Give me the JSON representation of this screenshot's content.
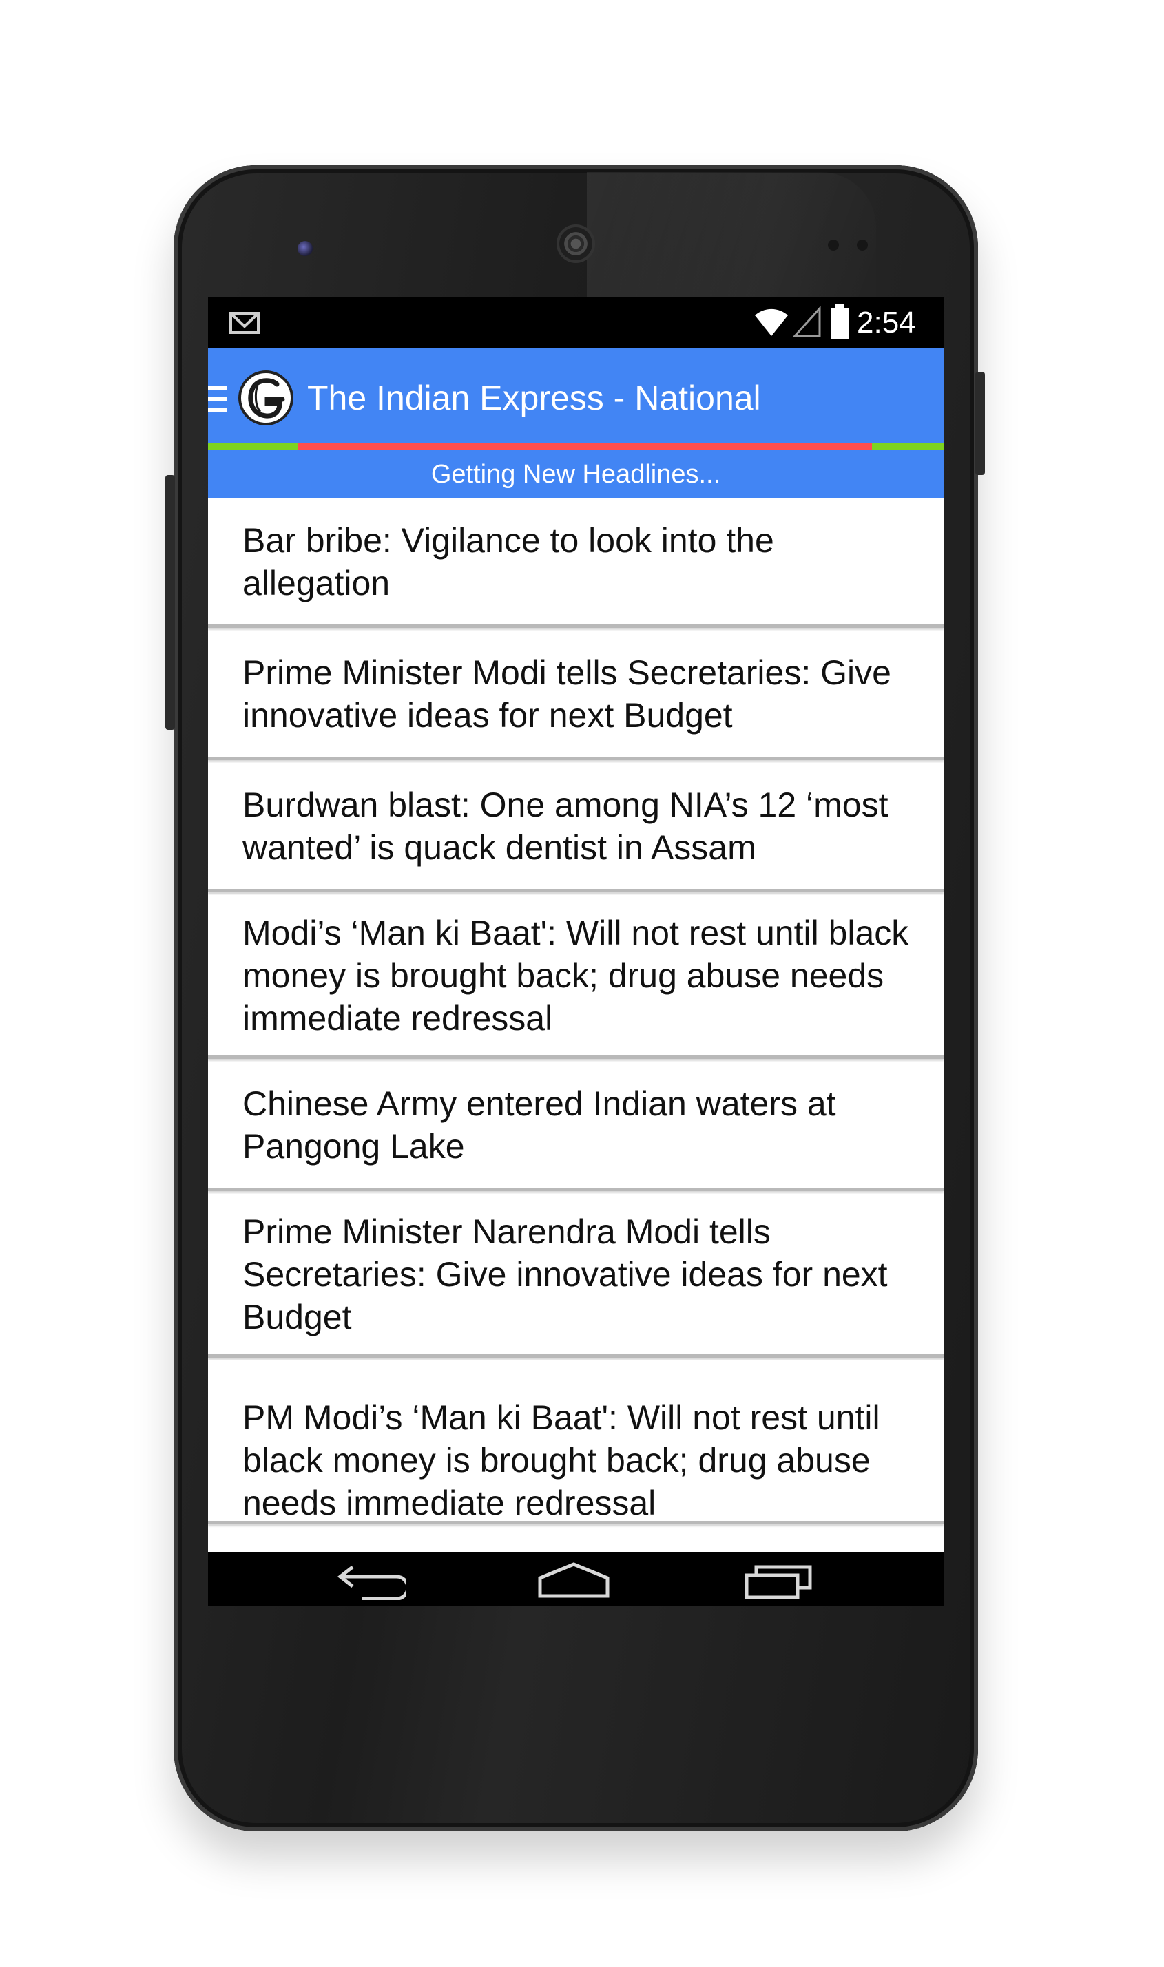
{
  "status_bar": {
    "time": "2:54",
    "icons": [
      "gmail-icon",
      "wifi-icon",
      "signal-icon",
      "battery-icon"
    ]
  },
  "app_bar": {
    "title": "The Indian Express - National",
    "icons": [
      "menu-icon",
      "newspaper-logo-icon"
    ],
    "color": "#4285f4"
  },
  "progress": {
    "label": "Getting New Headlines...",
    "indeterminate_colors": [
      "#7ed321",
      "#ff4e4e"
    ]
  },
  "headlines": [
    "Bar bribe: Vigilance to look into the allegation",
    "Prime Minister Modi tells Secretaries: Give innovative ideas for next Budget",
    "Burdwan blast: One among NIA’s 12 ‘most wanted’ is quack dentist in Assam",
    "Modi’s ‘Man ki Baat': Will not rest until black money is brought back; drug abuse needs immediate redressal",
    "Chinese Army entered Indian waters at Pangong Lake",
    "Prime Minister Narendra Modi tells Secretaries: Give innovative ideas for next Budget",
    "PM Modi’s ‘Man ki Baat': Will not rest until black money is brought back; drug abuse needs immediate redressal"
  ],
  "nav_bar": {
    "icons": [
      "back-icon",
      "home-icon",
      "recents-icon"
    ]
  }
}
